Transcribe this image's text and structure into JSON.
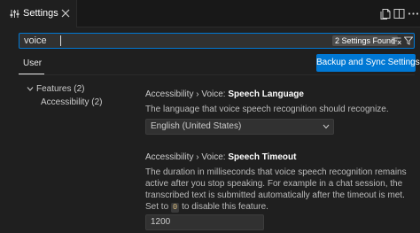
{
  "editor_tab": {
    "title": "Settings"
  },
  "search": {
    "value": "voice",
    "result_count": "2 Settings Found"
  },
  "scope": {
    "user_tab": "User",
    "sync_button": "Backup and Sync Settings"
  },
  "toc": {
    "items": [
      {
        "label": "Features (2)"
      },
      {
        "label": "Accessibility (2)"
      }
    ]
  },
  "settings": [
    {
      "category": "Accessibility › Voice: ",
      "name": "Speech Language",
      "description": "The language that voice speech recognition should recognize.",
      "value": "English (United States)"
    },
    {
      "category": "Accessibility › Voice: ",
      "name": "Speech Timeout",
      "description_before": "The duration in milliseconds that voice speech recognition remains active after you stop speaking. For example in a chat session, the transcribed text is submitted automatically after the timeout is met. Set to ",
      "description_code": "0",
      "description_after": " to disable this feature.",
      "value": "1200"
    }
  ],
  "colors": {
    "accent": "#0078d4",
    "background": "#1f1f1f"
  }
}
